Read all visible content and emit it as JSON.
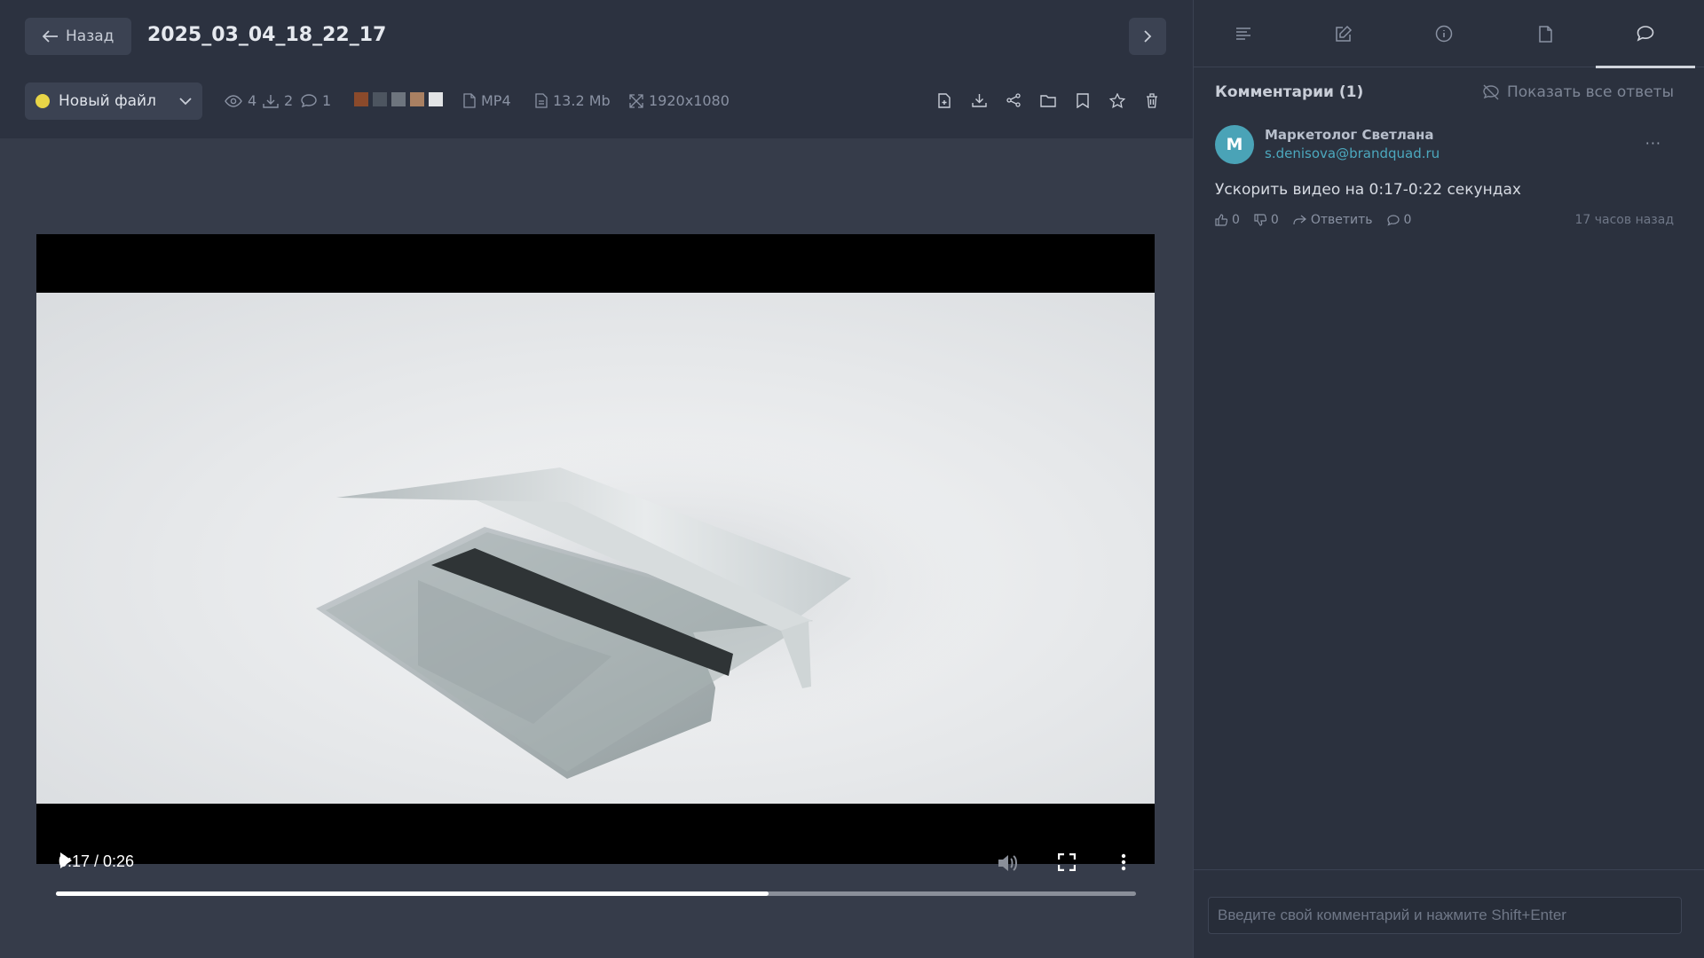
{
  "header": {
    "back_label": "Назад",
    "file_title": "2025_03_04_18_22_17"
  },
  "toolbar": {
    "status_label": "Новый файл",
    "status_color": "#e8d547",
    "views": "4",
    "downloads": "2",
    "comments_count": "1",
    "swatches": [
      "#8b4a2b",
      "#4d5560",
      "#6e757e",
      "#a98062",
      "#e2e4e6"
    ],
    "format": "MP4",
    "size": "13.2 Mb",
    "resolution": "1920x1080",
    "actions": [
      "file-add-icon",
      "download-icon",
      "share-icon",
      "folder-icon",
      "bookmark-icon",
      "star-icon",
      "trash-icon"
    ]
  },
  "player": {
    "time": "0:17 / 0:26",
    "progress": 0.66
  },
  "panel": {
    "tabs": [
      "list-icon",
      "edit-icon",
      "info-icon",
      "file-icon",
      "comment-icon"
    ],
    "active_tab": "comment-icon",
    "comments_title": "Комментарии (1)",
    "show_all_label": "Показать все ответы",
    "comment": {
      "avatar_letter": "М",
      "author": "Маркетолог Светлана",
      "email": "s.denisova@brandquad.ru",
      "text": "Ускорить видео на 0:17-0:22 секундах",
      "likes": "0",
      "dislikes": "0",
      "reply_label": "Ответить",
      "replies": "0",
      "time": "17 часов назад"
    },
    "input_placeholder": "Введите свой комментарий и нажмите Shift+Enter"
  }
}
